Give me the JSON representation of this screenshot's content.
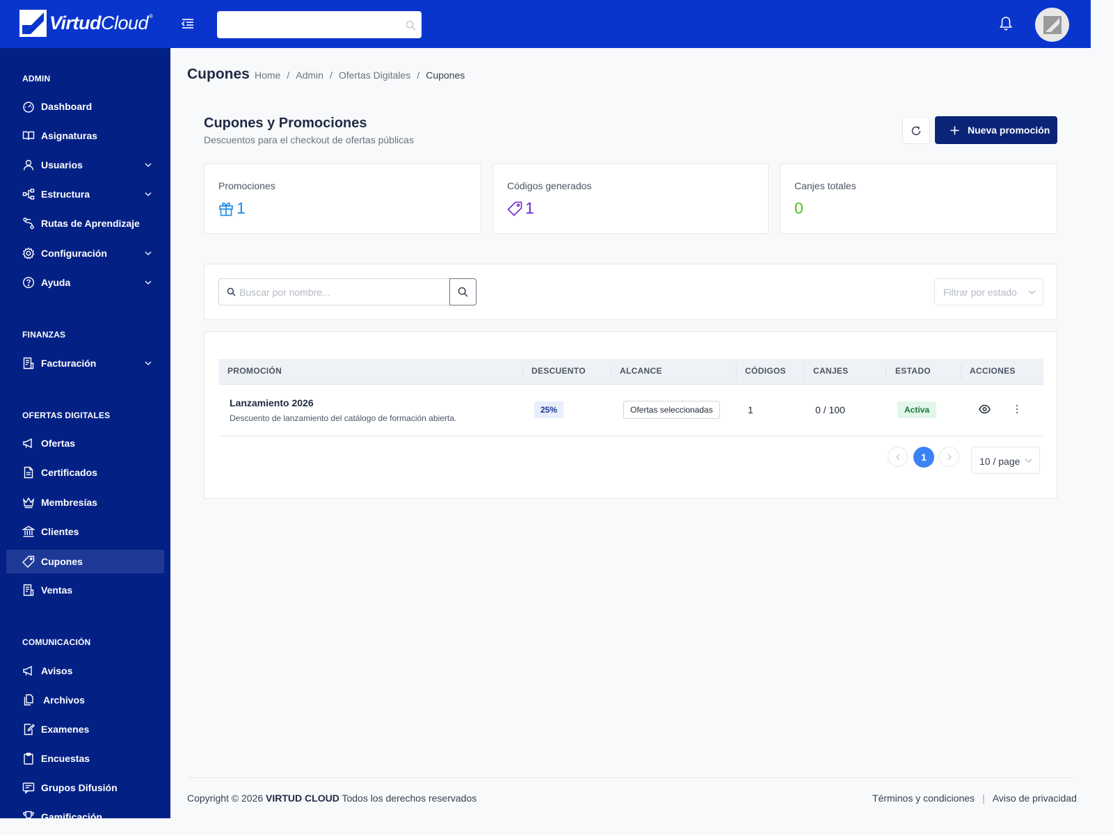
{
  "brand": {
    "bold": "Virtud",
    "light": "Cloud",
    "mark": "®"
  },
  "search": {
    "placeholder": ""
  },
  "sidebar": {
    "sections": [
      {
        "title": "ADMIN",
        "items": [
          {
            "label": "Dashboard",
            "icon": "dashboard-icon"
          },
          {
            "label": "Asignaturas",
            "icon": "book-icon"
          },
          {
            "label": "Usuarios",
            "icon": "user-icon",
            "expandable": true
          },
          {
            "label": "Estructura",
            "icon": "structure-icon",
            "expandable": true
          },
          {
            "label": "Rutas de Aprendizaje",
            "icon": "route-icon"
          },
          {
            "label": "Configuración",
            "icon": "gear-icon",
            "expandable": true
          },
          {
            "label": "Ayuda",
            "icon": "help-icon",
            "expandable": true
          }
        ]
      },
      {
        "title": "FINANZAS",
        "items": [
          {
            "label": "Facturación",
            "icon": "invoice-icon",
            "expandable": true
          }
        ]
      },
      {
        "title": "OFERTAS DIGITALES",
        "items": [
          {
            "label": "Ofertas",
            "icon": "megaphone-icon"
          },
          {
            "label": "Certificados",
            "icon": "document-icon"
          },
          {
            "label": "Membresías",
            "icon": "crown-icon"
          },
          {
            "label": "Clientes",
            "icon": "bank-icon"
          },
          {
            "label": "Cupones",
            "icon": "tag-icon",
            "active": true
          },
          {
            "label": "Ventas",
            "icon": "receipt-icon"
          }
        ]
      },
      {
        "title": "COMUNICACIÓN",
        "items": [
          {
            "label": "Avisos",
            "icon": "megaphone-icon"
          },
          {
            "label": "Archivos",
            "icon": "files-icon"
          },
          {
            "label": "Examenes",
            "icon": "exam-icon"
          },
          {
            "label": "Encuestas",
            "icon": "clipboard-icon"
          },
          {
            "label": "Grupos Difusión",
            "icon": "message-icon"
          },
          {
            "label": "Gamificación",
            "icon": "trophy-icon"
          }
        ]
      }
    ]
  },
  "page": {
    "title": "Cupones",
    "breadcrumb": [
      "Home",
      "Admin",
      "Ofertas Digitales",
      "Cupones"
    ]
  },
  "header": {
    "title": "Cupones y Promociones",
    "subtitle": "Descuentos para el checkout de ofertas públicas",
    "new_button": "Nueva promoción"
  },
  "stats": [
    {
      "label": "Promociones",
      "value": "1",
      "icon": "gift-icon",
      "color": "#1e88e5"
    },
    {
      "label": "Códigos generados",
      "value": "1",
      "icon": "tag-icon",
      "color": "#6d28d9"
    },
    {
      "label": "Canjes totales",
      "value": "0",
      "icon": "",
      "color": "#52c41a"
    }
  ],
  "filters": {
    "search_placeholder": "Buscar por nombre...",
    "status_placeholder": "Filtrar por estado"
  },
  "table": {
    "columns": [
      "PROMOCIÓN",
      "DESCUENTO",
      "ALCANCE",
      "CÓDIGOS",
      "CANJES",
      "ESTADO",
      "ACCIONES"
    ],
    "rows": [
      {
        "name": "Lanzamiento 2026",
        "description": "Descuento de lanzamiento del catálogo de formación abierta.",
        "discount": "25%",
        "scope": "Ofertas seleccionadas",
        "codes": "1",
        "redemptions": "0 / 100",
        "status": "Activa"
      }
    ]
  },
  "pagination": {
    "current": "1",
    "page_size": "10 / page"
  },
  "footer": {
    "copyright_prefix": "Copyright © 2026",
    "company": "VIRTUD CLOUD",
    "copyright_suffix": "Todos los derechos reservados",
    "terms": "Términos y condiciones",
    "privacy": "Aviso de privacidad"
  },
  "colors": {
    "topbar": "#0a35cc",
    "sidebar": "#032185",
    "primary_button": "#0a2477",
    "active_page": "#3b82f6",
    "status_active": "#16793b"
  }
}
